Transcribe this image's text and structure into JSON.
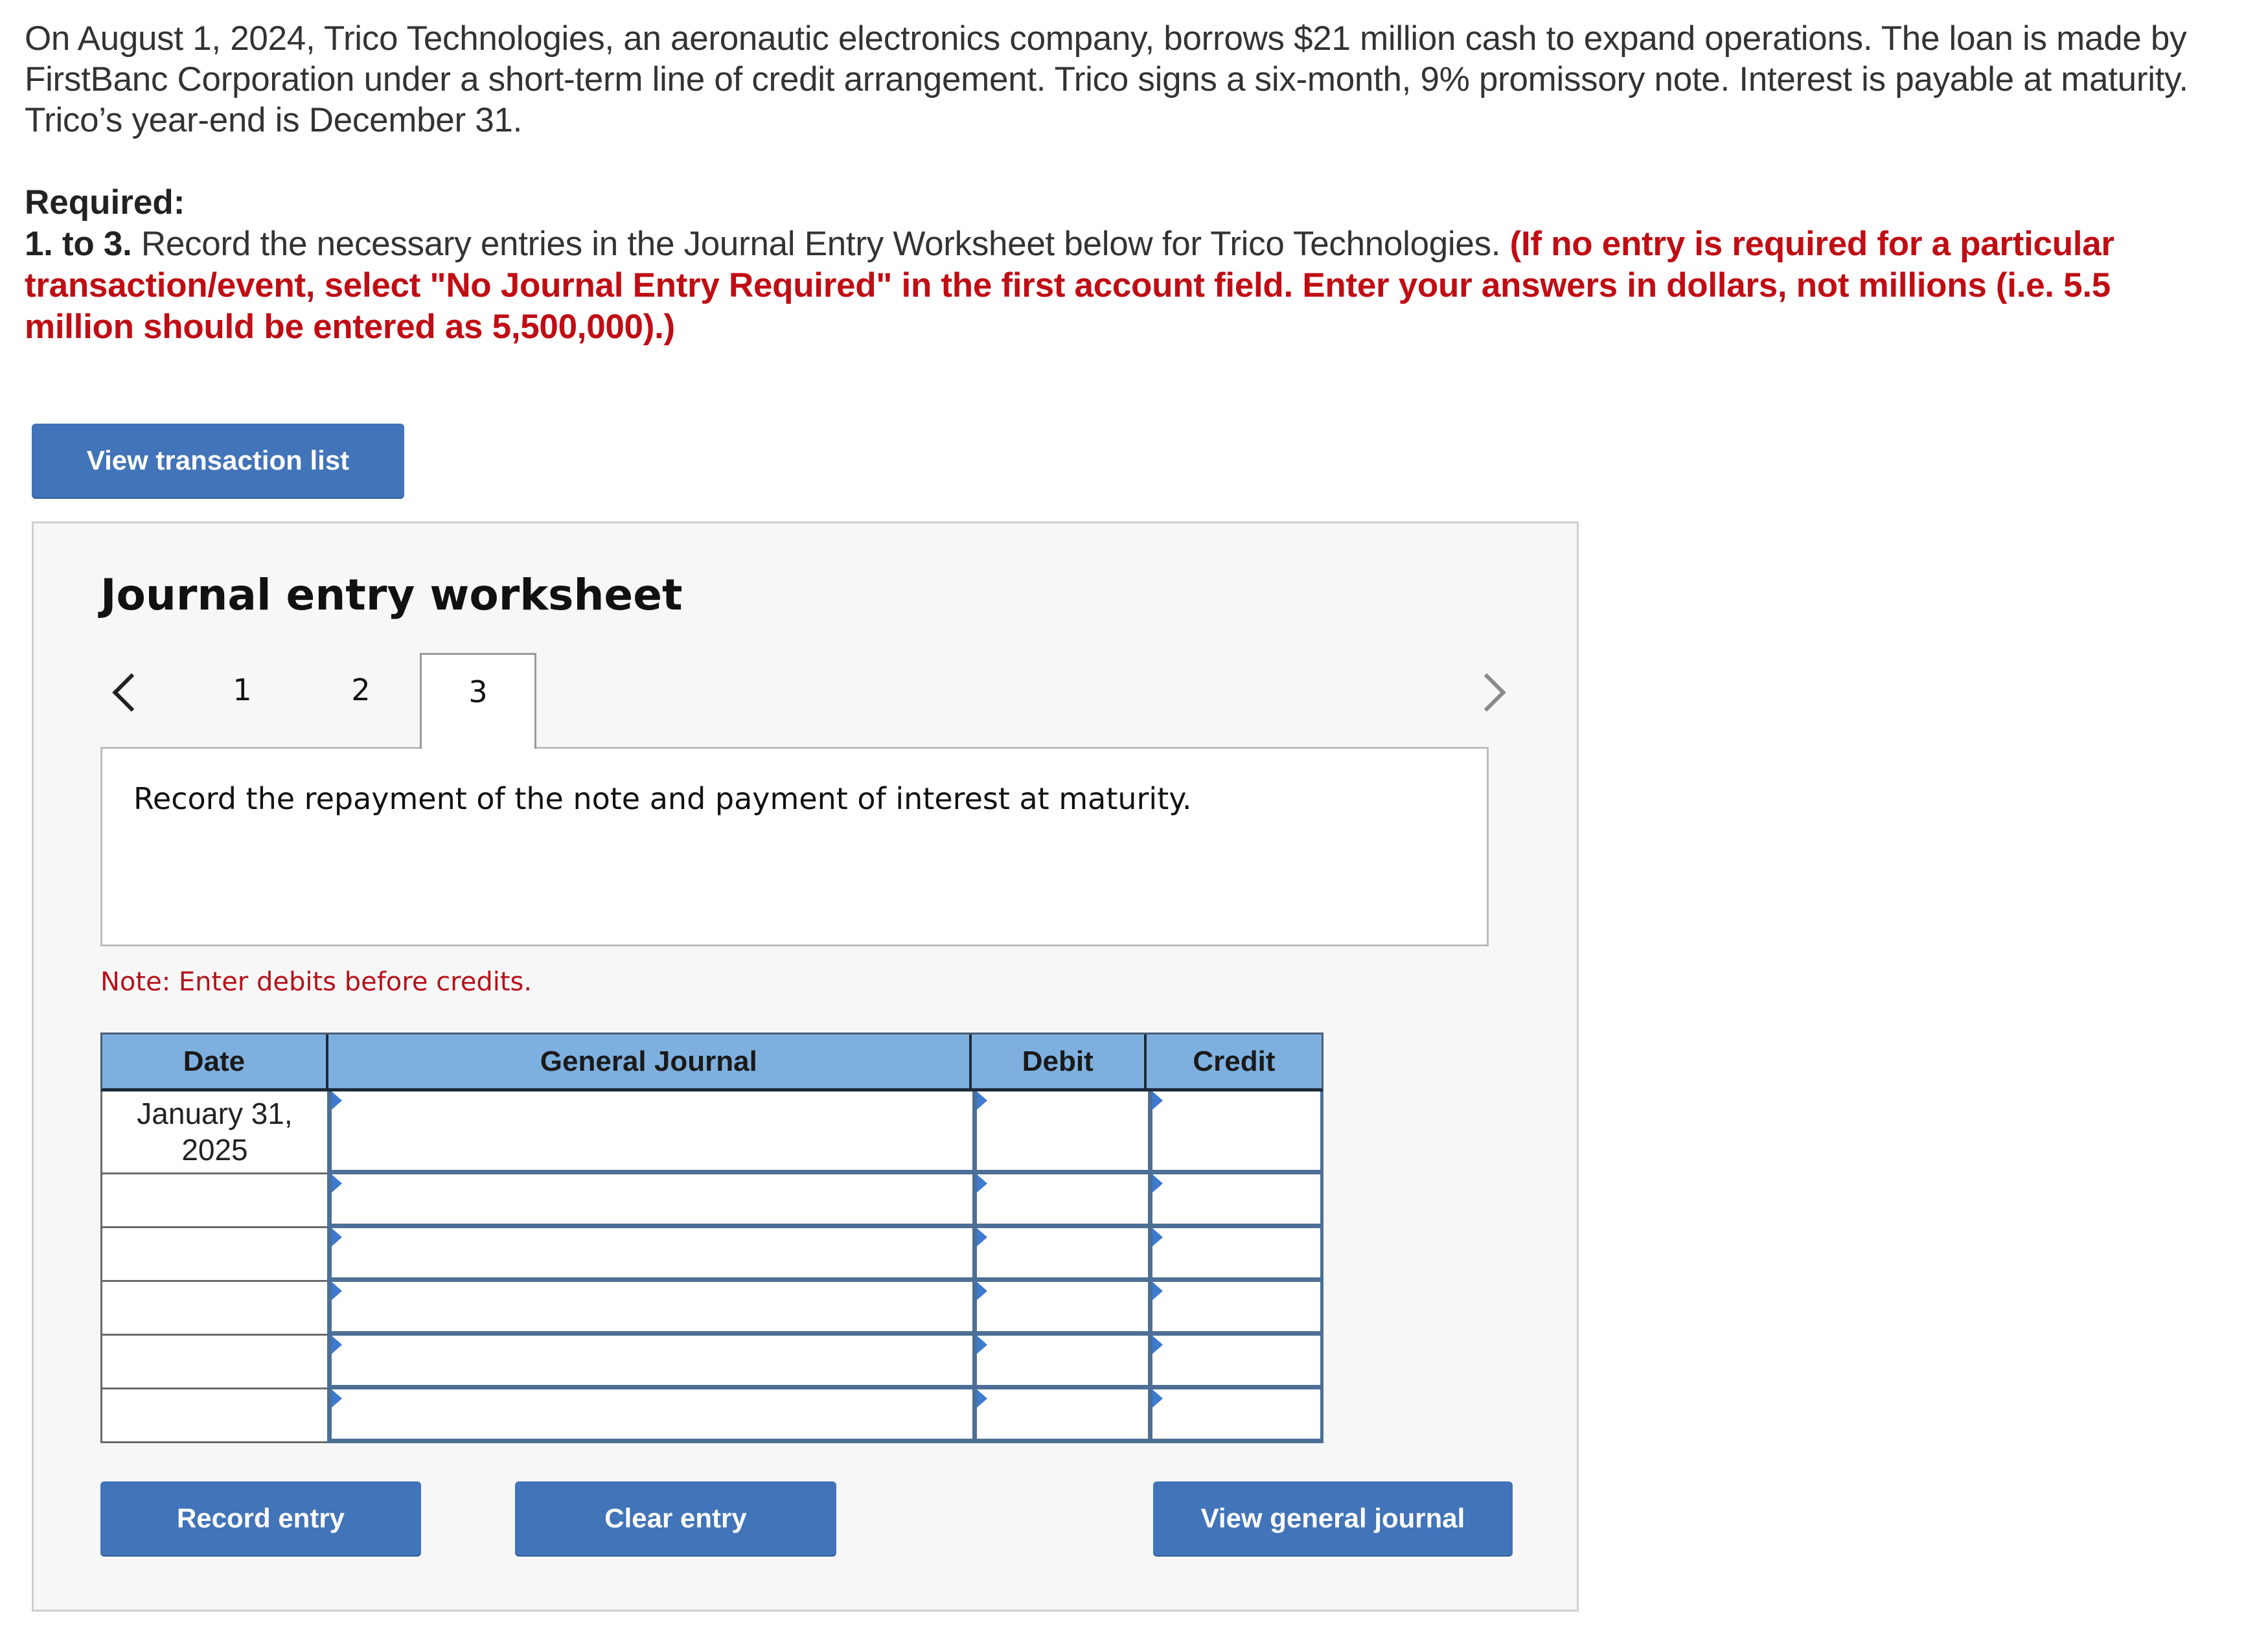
{
  "problem": {
    "intro": "On August 1, 2024, Trico Technologies, an aeronautic electronics company, borrows $21 million cash to expand operations. The loan is made by FirstBanc Corporation under a short-term line of credit arrangement. Trico signs a six-month, 9% promissory note. Interest is payable at maturity. Trico’s year-end is December 31.",
    "required_heading": "Required:",
    "required_number": "1. to 3.",
    "required_text": " Record the necessary entries in the Journal Entry Worksheet below for Trico Technologies. ",
    "required_red": "(If no entry is required for a particular transaction/event, select \"No Journal Entry Required\" in the first account field. Enter your answers in dollars, not millions (i.e. 5.5 million should be entered as 5,500,000).)"
  },
  "buttons": {
    "view_transaction_list": "View transaction list",
    "record_entry": "Record entry",
    "clear_entry": "Clear entry",
    "view_general_journal": "View general journal"
  },
  "worksheet": {
    "title": "Journal entry worksheet",
    "tabs": [
      {
        "label": "1",
        "active": false
      },
      {
        "label": "2",
        "active": false
      },
      {
        "label": "3",
        "active": true
      }
    ],
    "prev_icon": "chevron-left-icon",
    "next_icon": "chevron-right-icon",
    "next_disabled": true,
    "instruction": "Record the repayment of the note and payment of interest at maturity.",
    "note": "Note: Enter debits before credits."
  },
  "journal_table": {
    "headers": {
      "date": "Date",
      "general_journal": "General Journal",
      "debit": "Debit",
      "credit": "Credit"
    },
    "rows": [
      {
        "date": "January 31, 2025",
        "account": "",
        "debit": "",
        "credit": ""
      },
      {
        "date": "",
        "account": "",
        "debit": "",
        "credit": ""
      },
      {
        "date": "",
        "account": "",
        "debit": "",
        "credit": ""
      },
      {
        "date": "",
        "account": "",
        "debit": "",
        "credit": ""
      },
      {
        "date": "",
        "account": "",
        "debit": "",
        "credit": ""
      },
      {
        "date": "",
        "account": "",
        "debit": "",
        "credit": ""
      }
    ]
  },
  "colors": {
    "button": "#4174b8",
    "table_header": "#7eb0df",
    "input_border": "#4d6f96",
    "emphasis_red": "#c00d14",
    "note_red": "#b5121b",
    "panel_bg": "#f7f7f7"
  }
}
